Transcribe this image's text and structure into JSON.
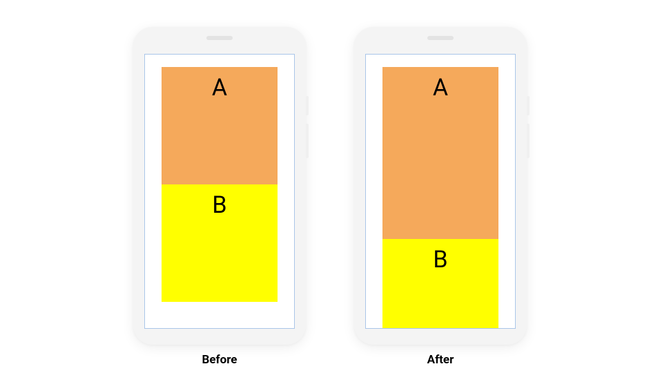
{
  "diagram": {
    "phones": [
      {
        "caption": "Before",
        "blocks": {
          "a": {
            "label": "A",
            "heightPercent": 45
          },
          "b": {
            "label": "B",
            "heightPercent": 45
          }
        }
      },
      {
        "caption": "After",
        "blocks": {
          "a": {
            "label": "A",
            "heightPercent": 66
          },
          "b": {
            "label": "B",
            "heightPercent": 34
          }
        }
      }
    ]
  },
  "colors": {
    "blockA": "#f5a95b",
    "blockB": "#ffff00",
    "phoneBody": "#f4f4f4",
    "screenBorder": "#aac6e8"
  }
}
